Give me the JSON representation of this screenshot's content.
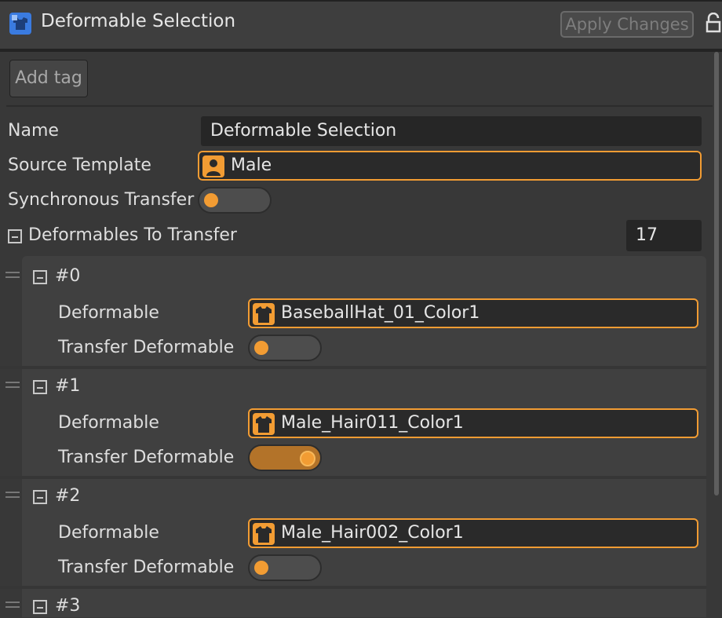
{
  "header": {
    "title": "Deformable Selection",
    "apply_label": "Apply Changes",
    "icon": "wardrobe-icon"
  },
  "tags": {
    "add_tag_label": "Add tag"
  },
  "fields": {
    "name_label": "Name",
    "name_value": "Deformable Selection",
    "source_template_label": "Source Template",
    "source_template_value": "Male",
    "sync_label": "Synchronous Transfer",
    "sync_on": false,
    "deformables_label": "Deformables To Transfer",
    "deformables_count": "17"
  },
  "items": [
    {
      "index": "#0",
      "deformable_label": "Deformable",
      "deformable_value": "BaseballHat_01_Color1",
      "transfer_label": "Transfer Deformable",
      "transfer_on": false
    },
    {
      "index": "#1",
      "deformable_label": "Deformable",
      "deformable_value": "Male_Hair011_Color1",
      "transfer_label": "Transfer Deformable",
      "transfer_on": true
    },
    {
      "index": "#2",
      "deformable_label": "Deformable",
      "deformable_value": "Male_Hair002_Color1",
      "transfer_label": "Transfer Deformable",
      "transfer_on": false
    },
    {
      "index": "#3"
    }
  ],
  "colors": {
    "accent": "#f29c33",
    "background": "#383838",
    "app_icon": "#3a7be0"
  }
}
